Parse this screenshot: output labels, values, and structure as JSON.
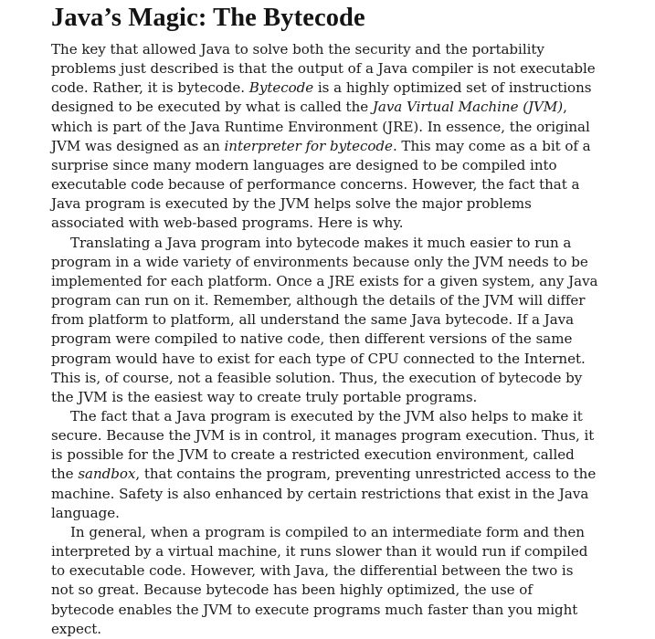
{
  "heading": "Java’s Magic: The Bytecode",
  "paragraphs": [
    {
      "indent": false,
      "segments": [
        {
          "text": "The key that allowed Java to solve both the security and the portability problems just described is that the output of a Java compiler is not executable code. Rather, it is bytecode. ",
          "italic": false
        },
        {
          "text": "Bytecode",
          "italic": true
        },
        {
          "text": " is a highly optimized set of instructions designed to be executed by what is called the ",
          "italic": false
        },
        {
          "text": "Java Virtual Machine (JVM)",
          "italic": true
        },
        {
          "text": ", which is part of the Java Runtime Environment (JRE). In essence, the original JVM was designed as an ",
          "italic": false
        },
        {
          "text": "interpreter for bytecode",
          "italic": true
        },
        {
          "text": ". This may come as a bit of a surprise since many modern languages are designed to be compiled into executable code because of performance concerns. However, the fact that a Java program is executed by the JVM helps solve the major problems associated with web-based programs. Here is why.",
          "italic": false
        }
      ]
    },
    {
      "indent": true,
      "segments": [
        {
          "text": "Translating a Java program into bytecode makes it much easier to run a program in a wide variety of environments because only the JVM needs to be implemented for each platform. Once a JRE exists for a given system, any Java program can run on it. Remember, although the details of the JVM will differ from platform to platform, all understand the same Java bytecode. If a Java program were compiled to native code, then different versions of the same program would have to exist for each type of CPU connected to the Internet. This is, of course, not a feasible solution. Thus, the execution of bytecode by the JVM is the easiest way to create truly portable programs.",
          "italic": false
        }
      ]
    },
    {
      "indent": true,
      "segments": [
        {
          "text": "The fact that a Java program is executed by the JVM also helps to make it secure. Because the JVM is in control, it manages program execution. Thus, it is possible for the JVM to create a restricted execution environment, called the ",
          "italic": false
        },
        {
          "text": "sandbox",
          "italic": true
        },
        {
          "text": ", that contains the program, preventing unrestricted access to the machine. Safety is also enhanced by certain restrictions that exist in the Java language.",
          "italic": false
        }
      ]
    },
    {
      "indent": true,
      "segments": [
        {
          "text": "In general, when a program is compiled to an intermediate form and then interpreted by a virtual machine, it runs slower than it would run if compiled to executable code. However, with Java, the differential between the two is not so great. Because bytecode has been highly optimized, the use of bytecode enables the JVM to execute programs much faster than you might expect.",
          "italic": false
        }
      ]
    }
  ]
}
